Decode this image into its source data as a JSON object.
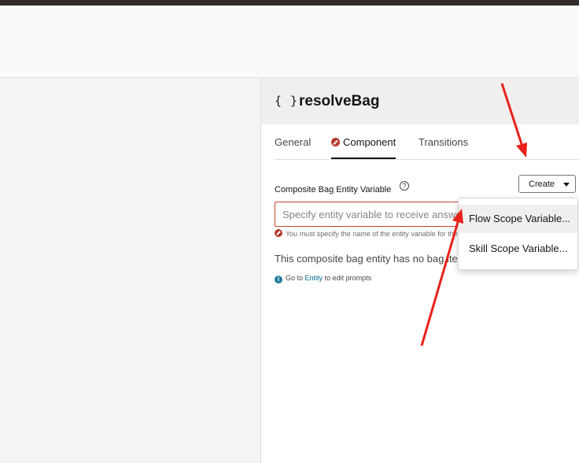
{
  "panel": {
    "braces": "{ }",
    "title": "resolveBag"
  },
  "tabs": [
    {
      "label": "General",
      "active": false
    },
    {
      "label": "Component",
      "active": true,
      "error": true
    },
    {
      "label": "Transitions",
      "active": false
    }
  ],
  "form": {
    "field_label": "Composite Bag Entity Variable",
    "help": "?",
    "create_label": "Create",
    "input_placeholder": "Specify entity variable to receive answer",
    "error_message": "You must specify the name of the entity variable for the composite bag",
    "info_text": "This composite bag entity has no bag items",
    "goto_prefix": "Go to",
    "goto_link": "Entity",
    "goto_suffix": "to edit prompts",
    "info_icon": "i"
  },
  "dropdown": {
    "items": [
      "Flow Scope Variable...",
      "Skill Scope Variable..."
    ]
  },
  "colors": {
    "error": "#c74634",
    "link": "#006b8f",
    "annotation_arrow": "#e8221a"
  }
}
